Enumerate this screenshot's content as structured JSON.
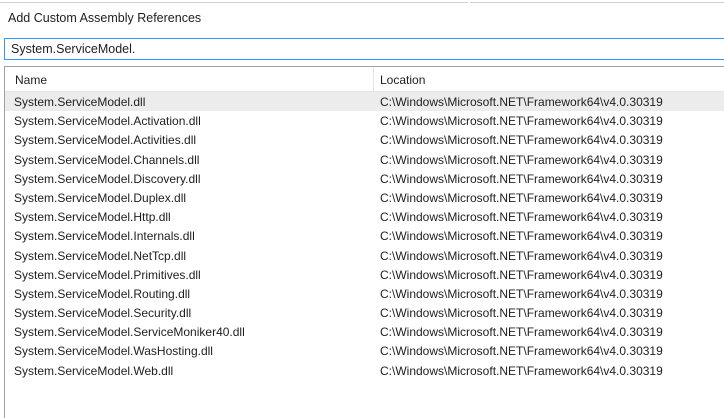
{
  "dialog": {
    "title": "Add Custom Assembly References"
  },
  "search": {
    "value": "System.ServiceModel."
  },
  "list": {
    "columns": {
      "name": "Name",
      "location": "Location"
    },
    "selected_index": 0,
    "rows": [
      {
        "name": "System.ServiceModel.dll",
        "location": "C:\\Windows\\Microsoft.NET\\Framework64\\v4.0.30319"
      },
      {
        "name": "System.ServiceModel.Activation.dll",
        "location": "C:\\Windows\\Microsoft.NET\\Framework64\\v4.0.30319"
      },
      {
        "name": "System.ServiceModel.Activities.dll",
        "location": "C:\\Windows\\Microsoft.NET\\Framework64\\v4.0.30319"
      },
      {
        "name": "System.ServiceModel.Channels.dll",
        "location": "C:\\Windows\\Microsoft.NET\\Framework64\\v4.0.30319"
      },
      {
        "name": "System.ServiceModel.Discovery.dll",
        "location": "C:\\Windows\\Microsoft.NET\\Framework64\\v4.0.30319"
      },
      {
        "name": "System.ServiceModel.Duplex.dll",
        "location": "C:\\Windows\\Microsoft.NET\\Framework64\\v4.0.30319"
      },
      {
        "name": "System.ServiceModel.Http.dll",
        "location": "C:\\Windows\\Microsoft.NET\\Framework64\\v4.0.30319"
      },
      {
        "name": "System.ServiceModel.Internals.dll",
        "location": "C:\\Windows\\Microsoft.NET\\Framework64\\v4.0.30319"
      },
      {
        "name": "System.ServiceModel.NetTcp.dll",
        "location": "C:\\Windows\\Microsoft.NET\\Framework64\\v4.0.30319"
      },
      {
        "name": "System.ServiceModel.Primitives.dll",
        "location": "C:\\Windows\\Microsoft.NET\\Framework64\\v4.0.30319"
      },
      {
        "name": "System.ServiceModel.Routing.dll",
        "location": "C:\\Windows\\Microsoft.NET\\Framework64\\v4.0.30319"
      },
      {
        "name": "System.ServiceModel.Security.dll",
        "location": "C:\\Windows\\Microsoft.NET\\Framework64\\v4.0.30319"
      },
      {
        "name": "System.ServiceModel.ServiceMoniker40.dll",
        "location": "C:\\Windows\\Microsoft.NET\\Framework64\\v4.0.30319"
      },
      {
        "name": "System.ServiceModel.WasHosting.dll",
        "location": "C:\\Windows\\Microsoft.NET\\Framework64\\v4.0.30319"
      },
      {
        "name": "System.ServiceModel.Web.dll",
        "location": "C:\\Windows\\Microsoft.NET\\Framework64\\v4.0.30319"
      }
    ]
  },
  "colors": {
    "focus_border": "#3399ff",
    "selected_row": "#ececec"
  }
}
